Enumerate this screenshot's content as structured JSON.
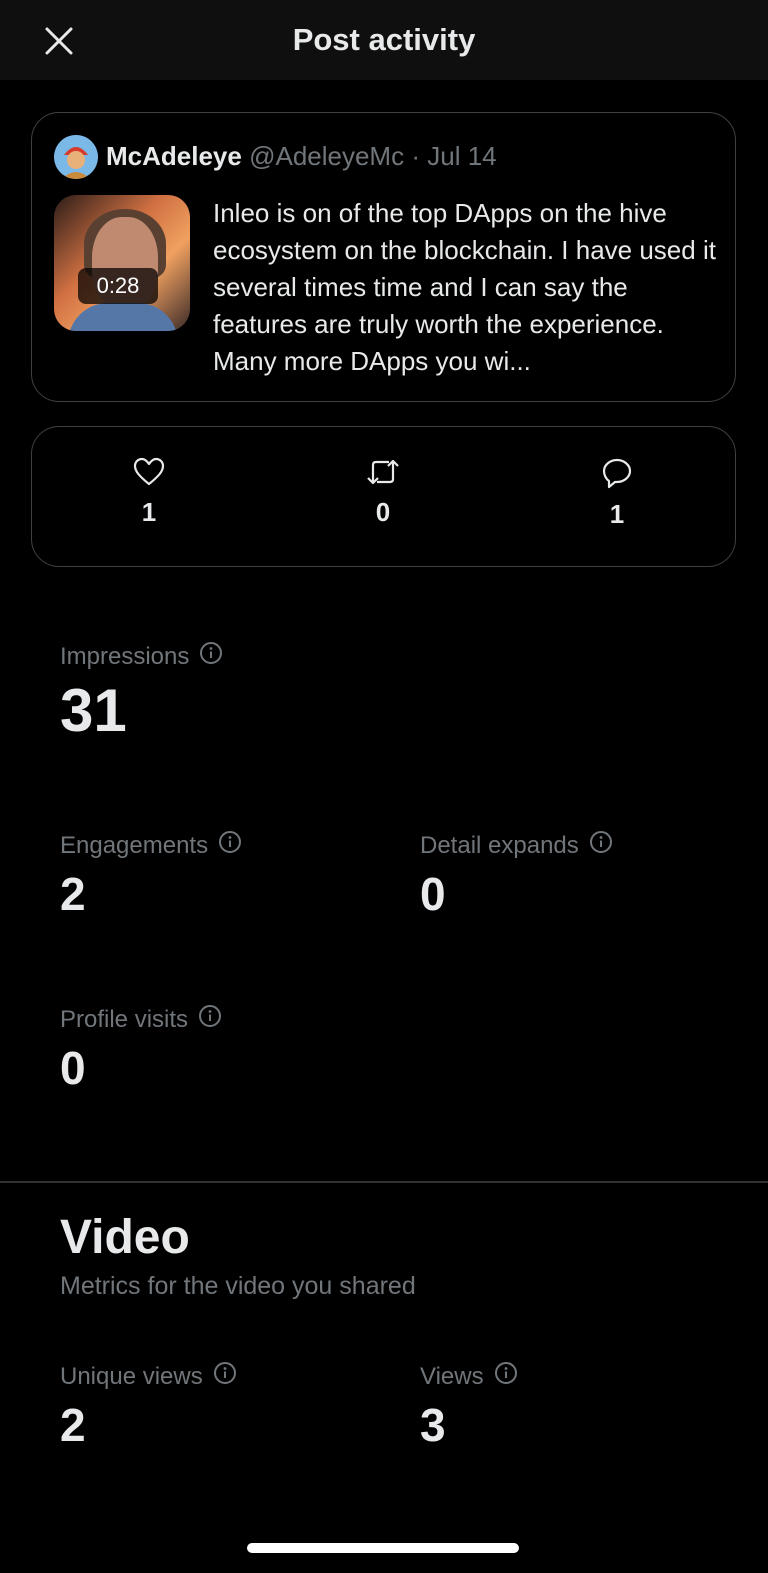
{
  "header": {
    "title": "Post activity",
    "close_icon": "close-icon"
  },
  "post": {
    "author_name": "McAdeleye",
    "author_handle": "@AdeleyeMc",
    "separator": "·",
    "date": "Jul 14",
    "video_duration": "0:28",
    "text": "Inleo is on of the top DApps on the hive ecosystem on the blockchain. I have used it several times time and I can say the features are truly worth the experience. Many more DApps you wi..."
  },
  "engagement": {
    "likes": "1",
    "reposts": "0",
    "replies": "1"
  },
  "metrics": {
    "impressions": {
      "label": "Impressions",
      "value": "31"
    },
    "engagements": {
      "label": "Engagements",
      "value": "2"
    },
    "detail_expands": {
      "label": "Detail expands",
      "value": "0"
    },
    "profile_visits": {
      "label": "Profile visits",
      "value": "0"
    }
  },
  "video": {
    "title": "Video",
    "subtitle": "Metrics for the video you shared",
    "unique_views": {
      "label": "Unique views",
      "value": "2"
    },
    "views": {
      "label": "Views",
      "value": "3"
    }
  },
  "colors": {
    "background": "#000000",
    "primary_text": "#e7e9ea",
    "secondary_text": "#71767b",
    "border": "#3e4144"
  }
}
